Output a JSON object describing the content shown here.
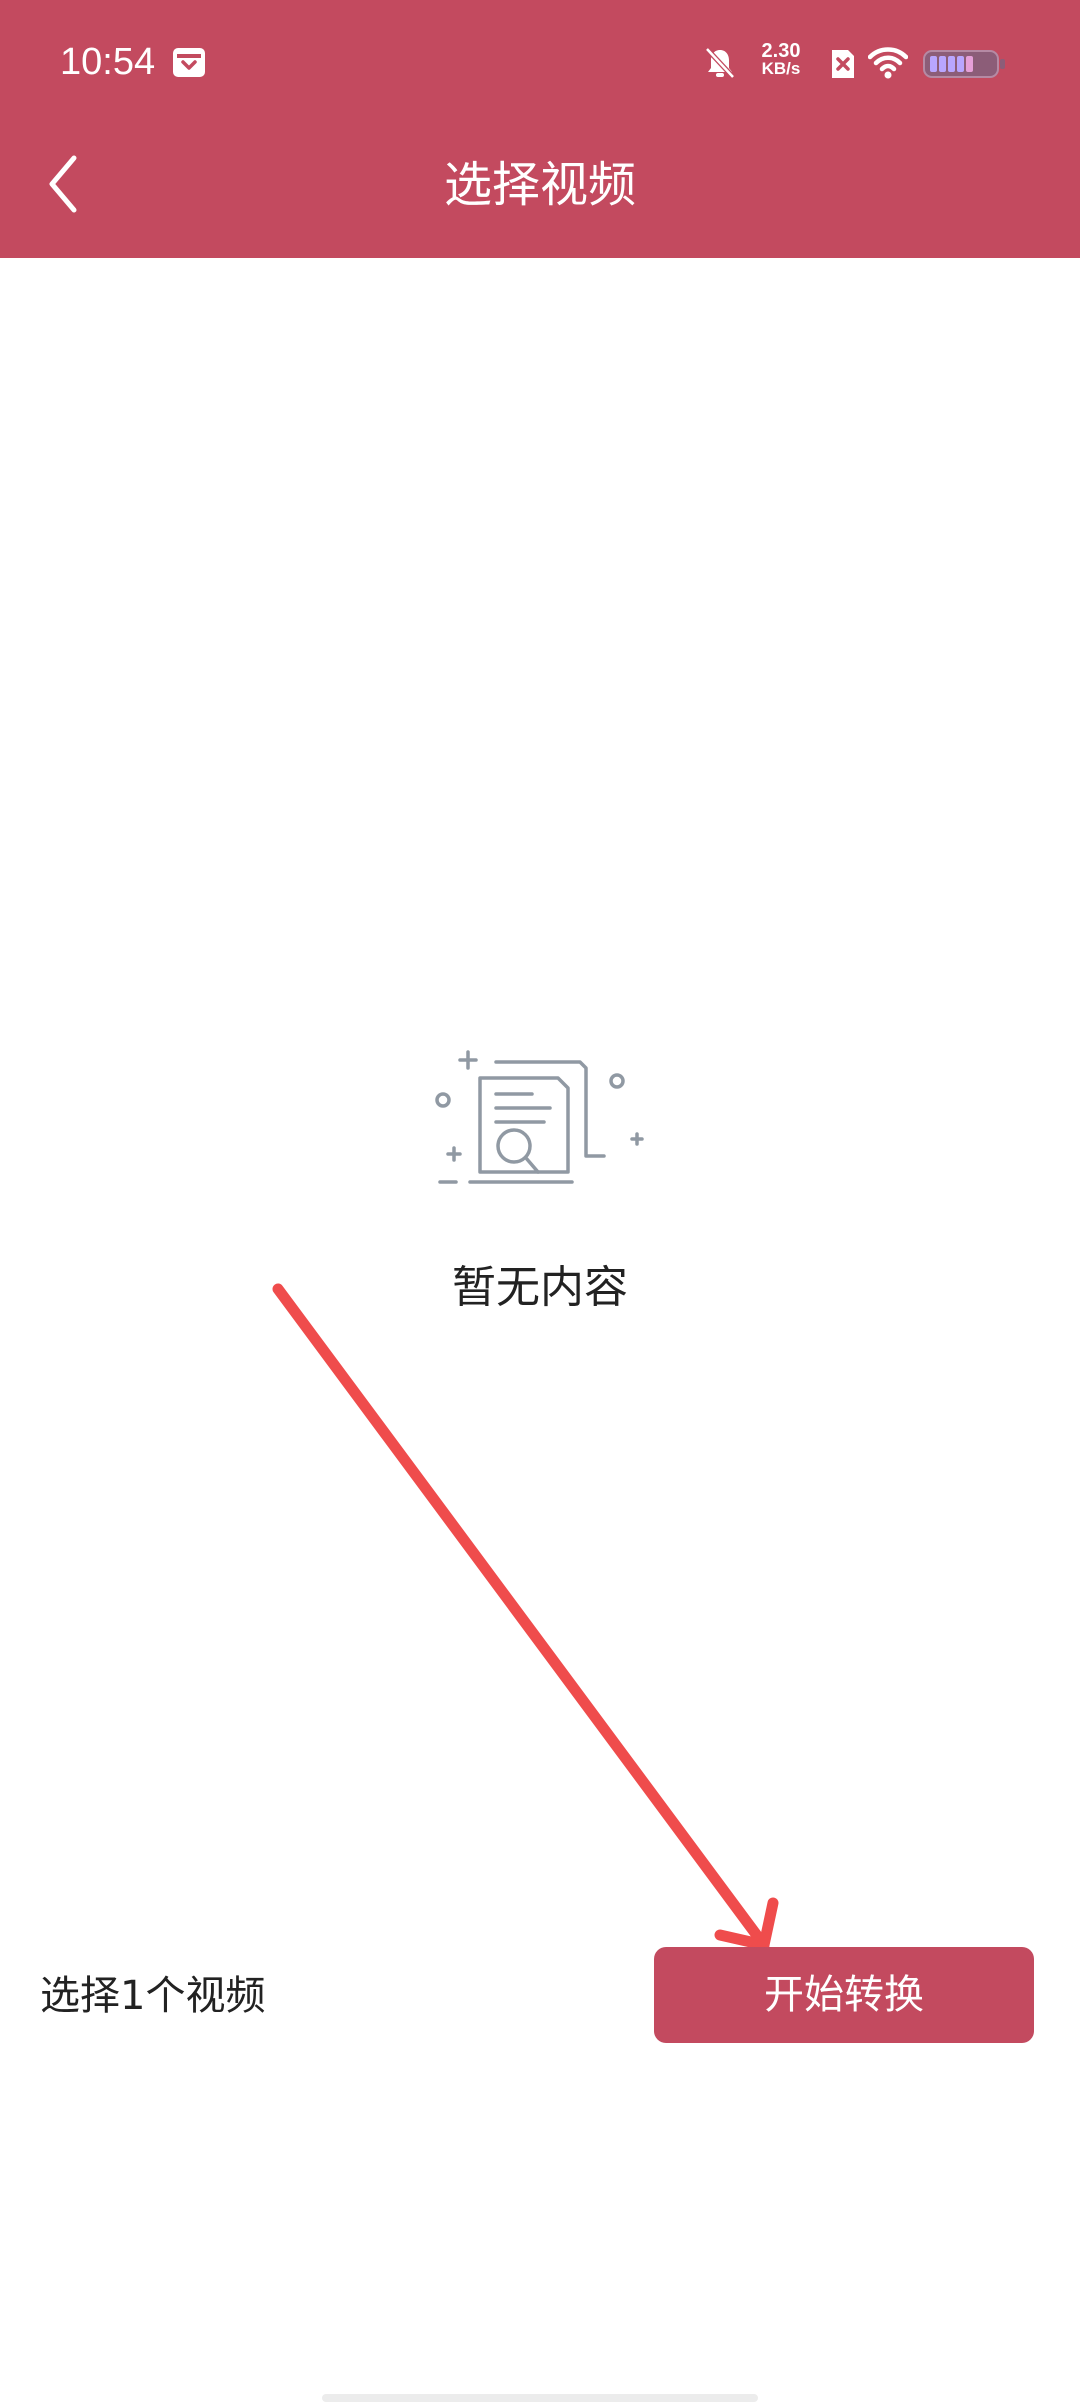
{
  "status_bar": {
    "time": "10:54",
    "net_speed_value": "2.30",
    "net_speed_unit": "KB/s",
    "icons": [
      "calendar-icon",
      "mute-bell-icon",
      "sim-x-icon",
      "wifi-icon",
      "battery-icon"
    ],
    "battery_level": 0.6
  },
  "header": {
    "title": "选择视频",
    "back_icon": "chevron-left-icon",
    "background": "#c34a5f"
  },
  "empty_state": {
    "icon": "document-search-icon",
    "text": "暂无内容"
  },
  "footer": {
    "selection_text": "选择1个视频",
    "start_button_label": "开始转换"
  },
  "annotation": {
    "arrow_color": "#ef4c4c"
  },
  "colors": {
    "accent": "#c34a5f",
    "text": "#222222",
    "icon_gray": "#9099a3"
  }
}
